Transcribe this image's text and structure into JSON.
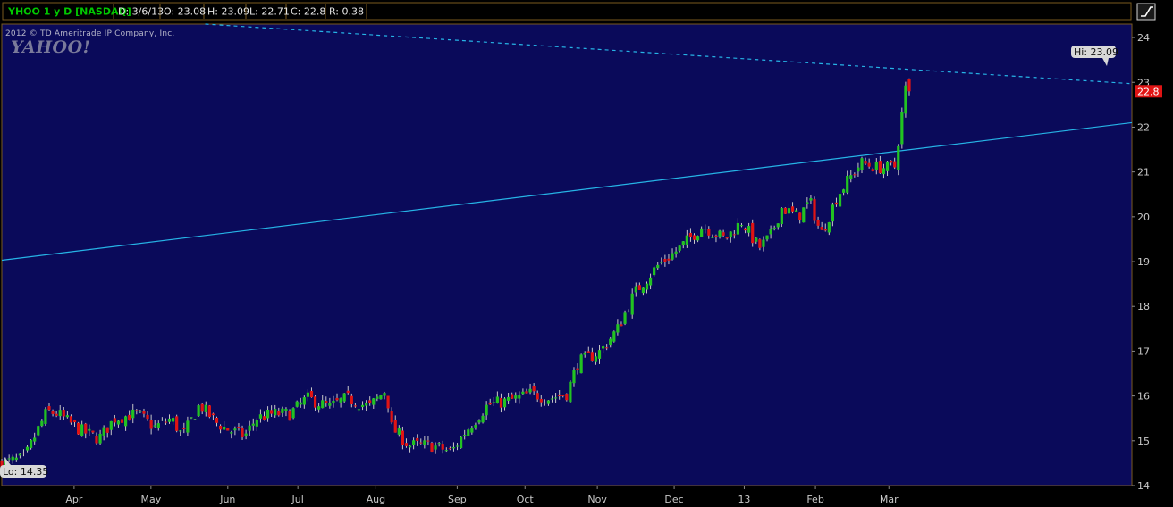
{
  "header": {
    "symbol": "YHOO 1 y D [NASDAQ]",
    "date": "D: 3/6/13",
    "open": "O: 23.08",
    "high": "H: 23.09",
    "low": "L: 22.71",
    "close": "C: 22.8",
    "range": "R: 0.38"
  },
  "watermark": {
    "copyright": "2012 © TD Ameritrade IP Company, Inc.",
    "logo": "YAHOO!"
  },
  "callouts": {
    "hi": "Hi: 23.09",
    "lo": "Lo: 14.35",
    "last": "22.8"
  },
  "toolbar": {
    "drawing_tool_icon": "trendline-tool-icon"
  },
  "colors": {
    "background": "#0a0a5a",
    "up": "#22c322",
    "down": "#e01414",
    "wick": "#c8c8c8",
    "trendline": "#26b4e6",
    "border": "#7a5a1e"
  },
  "chart_data": {
    "type": "candlestick",
    "ylim": [
      14,
      24.3
    ],
    "yticks": [
      14,
      15,
      16,
      17,
      18,
      19,
      20,
      21,
      22,
      23,
      24
    ],
    "xticks": [
      "Apr",
      "May",
      "Jun",
      "Jul",
      "Aug",
      "Sep",
      "Oct",
      "Nov",
      "Dec",
      "13",
      "Feb",
      "Mar"
    ],
    "x_positions": [
      0.064,
      0.132,
      0.2,
      0.262,
      0.331,
      0.403,
      0.463,
      0.527,
      0.595,
      0.657,
      0.72,
      0.785
    ],
    "hi": 23.09,
    "lo": 14.35,
    "last": 22.8,
    "hi_label": "Hi: 23.09",
    "lo_label": "Lo: 14.35",
    "last_label": "22.8",
    "trendlines": [
      {
        "style": "solid",
        "from": [
          0,
          19.03
        ],
        "to": [
          1,
          22.1
        ]
      },
      {
        "style": "dashed",
        "from": [
          0.18,
          24.3
        ],
        "to": [
          1,
          22.97
        ]
      }
    ],
    "anchors": [
      [
        0,
        14.5
      ],
      [
        0.02,
        14.6
      ],
      [
        0.032,
        15.25
      ],
      [
        0.04,
        15.65
      ],
      [
        0.05,
        15.6
      ],
      [
        0.06,
        15.4
      ],
      [
        0.072,
        15.2
      ],
      [
        0.086,
        15.05
      ],
      [
        0.1,
        15.5
      ],
      [
        0.12,
        15.6
      ],
      [
        0.135,
        15.3
      ],
      [
        0.15,
        15.5
      ],
      [
        0.16,
        15.1
      ],
      [
        0.175,
        15.8
      ],
      [
        0.19,
        15.4
      ],
      [
        0.2,
        15.25
      ],
      [
        0.215,
        15.1
      ],
      [
        0.225,
        15.5
      ],
      [
        0.24,
        15.6
      ],
      [
        0.255,
        15.6
      ],
      [
        0.27,
        15.95
      ],
      [
        0.29,
        15.75
      ],
      [
        0.305,
        15.95
      ],
      [
        0.325,
        15.75
      ],
      [
        0.34,
        16.15
      ],
      [
        0.345,
        15.3
      ],
      [
        0.36,
        14.9
      ],
      [
        0.38,
        14.9
      ],
      [
        0.398,
        14.75
      ],
      [
        0.41,
        15.2
      ],
      [
        0.43,
        15.8
      ],
      [
        0.45,
        15.9
      ],
      [
        0.468,
        16.05
      ],
      [
        0.485,
        15.95
      ],
      [
        0.5,
        16.05
      ],
      [
        0.51,
        16.75
      ],
      [
        0.53,
        17.0
      ],
      [
        0.545,
        17.5
      ],
      [
        0.56,
        18.3
      ],
      [
        0.58,
        18.9
      ],
      [
        0.6,
        19.3
      ],
      [
        0.62,
        19.8
      ],
      [
        0.64,
        19.5
      ],
      [
        0.655,
        19.9
      ],
      [
        0.67,
        19.3
      ],
      [
        0.68,
        19.55
      ],
      [
        0.69,
        20.2
      ],
      [
        0.705,
        20.0
      ],
      [
        0.715,
        20.35
      ],
      [
        0.725,
        19.6
      ],
      [
        0.74,
        20.5
      ],
      [
        0.76,
        21.2
      ],
      [
        0.775,
        21.1
      ],
      [
        0.79,
        21.1
      ],
      [
        0.8,
        22.9
      ],
      [
        0.803,
        22.8
      ]
    ]
  }
}
